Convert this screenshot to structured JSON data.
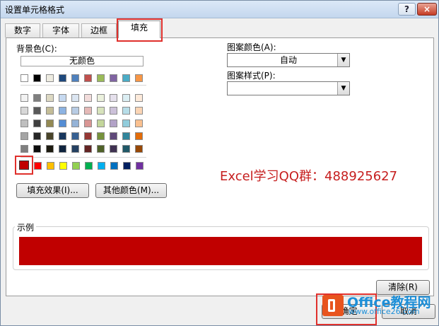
{
  "window": {
    "title": "设置单元格格式",
    "help_label": "?",
    "close_label": "×"
  },
  "tabs": [
    {
      "label": "数字"
    },
    {
      "label": "字体"
    },
    {
      "label": "边框"
    },
    {
      "label": "填充"
    }
  ],
  "fill": {
    "bg_label": "背景色(C):",
    "no_color_label": "无颜色",
    "theme_row1": [
      "#ffffff",
      "#000000",
      "#eeece1",
      "#1f497d",
      "#4f81bd",
      "#c0504d",
      "#9bbb59",
      "#8064a2",
      "#4bacc6",
      "#f79646"
    ],
    "tints": [
      [
        "#f2f2f2",
        "#7f7f7f",
        "#ddd9c3",
        "#c6d9f0",
        "#dbe5f1",
        "#f2dcdb",
        "#ebf1dd",
        "#e5e0ec",
        "#dbeef3",
        "#fdeada"
      ],
      [
        "#d8d8d8",
        "#595959",
        "#c4bd97",
        "#8db3e2",
        "#b8cce4",
        "#e5b9b7",
        "#d7e3bc",
        "#ccc1d9",
        "#b7dde8",
        "#fbd5b5"
      ],
      [
        "#bfbfbf",
        "#3f3f3f",
        "#938953",
        "#548dd4",
        "#95b3d7",
        "#d99694",
        "#c3d69b",
        "#b2a2c7",
        "#92cddc",
        "#fac08f"
      ],
      [
        "#a5a5a5",
        "#262626",
        "#494429",
        "#17365d",
        "#366092",
        "#953734",
        "#76923c",
        "#5f497a",
        "#31859b",
        "#e36c09"
      ],
      [
        "#7f7f7f",
        "#0c0c0c",
        "#1d1b10",
        "#0f243e",
        "#244061",
        "#632423",
        "#4f6128",
        "#3f3151",
        "#205867",
        "#974806"
      ]
    ],
    "standard": [
      "#c00000",
      "#ff0000",
      "#ffc000",
      "#ffff00",
      "#92d050",
      "#00b050",
      "#00b0f0",
      "#0070c0",
      "#002060",
      "#7030a0"
    ],
    "selected_color": "#c00000",
    "fill_effects_label": "填充效果(I)...",
    "more_colors_label": "其他颜色(M)...",
    "pattern_color_label": "图案颜色(A):",
    "pattern_color_value": "自动",
    "pattern_style_label": "图案样式(P):",
    "pattern_style_value": "",
    "sample_label": "示例",
    "clear_label": "清除(R)"
  },
  "overlay": {
    "promo_text": "Excel学习QQ群：488925627"
  },
  "footer": {
    "ok_label": "确定",
    "cancel_label": "取消"
  },
  "watermark": {
    "brand": "Office教程网",
    "url": "www.office26.com"
  }
}
